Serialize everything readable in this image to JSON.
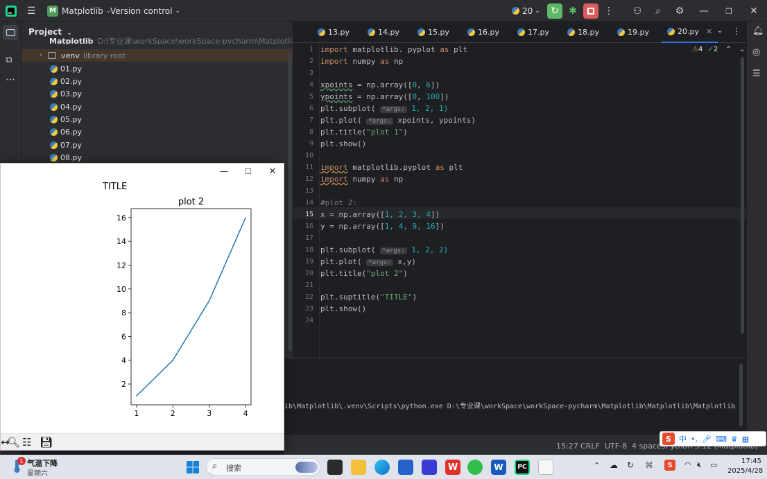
{
  "titlebar": {
    "project_badge": "M",
    "project_name": "Matplotlib",
    "version_control": "Version control",
    "python_version": "20"
  },
  "project_panel": {
    "header": "Project",
    "root_label": "Matplotlib",
    "root_path": "D:\\专业课\\workSpace\\workSpace-pycharm\\Matplotlib\\Matplotlib",
    "venv": ".venv",
    "venv_note": "library root",
    "files": [
      "01.py",
      "02.py",
      "03.py",
      "04.py",
      "05.py",
      "06.py",
      "07.py",
      "08.py"
    ]
  },
  "tabs": [
    "13.py",
    "14.py",
    "15.py",
    "16.py",
    "17.py",
    "18.py",
    "19.py",
    "20.py"
  ],
  "active_tab": "20.py",
  "inspections": {
    "warnings": "4",
    "ok": "2"
  },
  "code_lines": [
    "1",
    "2",
    "3",
    "4",
    "5",
    "6",
    "7",
    "8",
    "9",
    "10",
    "11",
    "12",
    "13",
    "14",
    "15",
    "16",
    "17",
    "18",
    "19",
    "20",
    "21",
    "22",
    "23",
    "24"
  ],
  "code": {
    "l1_a": "import",
    "l1_b": " matplotlib. pyplot ",
    "l1_c": "as",
    "l1_d": " plt",
    "l2_a": "import",
    "l2_b": " numpy ",
    "l2_c": "as",
    "l2_d": " np",
    "l4_a": "xpoints",
    "l4_b": " = np.array([",
    "l4_c": "0",
    "l4_d": ", ",
    "l4_e": "6",
    "l4_f": "])",
    "l5_a": "ypoints",
    "l5_b": " = np.array([",
    "l5_c": "0",
    "l5_d": ", ",
    "l5_e": "100",
    "l5_f": "])",
    "l6_a": "plt.subplot( ",
    "l6_hint": "*args:",
    "l6_b": " 1, 2, 1)",
    "l7_a": "plt.plot( ",
    "l7_hint": "*args:",
    "l7_b": " xpoints, ypoints)",
    "l8_a": "plt.title(",
    "l8_b": "\"plot 1\"",
    "l8_c": ")",
    "l9": "plt.show()",
    "l11_a": "import",
    "l11_b": " matplotlib.pyplot ",
    "l11_c": "as",
    "l11_d": " plt",
    "l12_a": "import",
    "l12_b": " numpy ",
    "l12_c": "as",
    "l12_d": " np",
    "l14": "#plot 2:",
    "l15_a": "x = np.array([",
    "l15_b": "1, 2, 3, 4",
    "l15_c": "])",
    "l16_a": "y = np.array([",
    "l16_b": "1, 4, 9, 16",
    "l16_c": "])",
    "l18_a": "plt.subplot( ",
    "l18_hint": "*args:",
    "l18_b": " 1, 2, 2)",
    "l19_a": "plt.plot( ",
    "l19_hint": "*args:",
    "l19_b": " x,y)",
    "l20_a": "plt.title(",
    "l20_b": "\"plot 2\"",
    "l20_c": ")",
    "l22_a": "plt.suptitle(",
    "l22_b": "\"TITLE\"",
    "l22_c": ")",
    "l23": "plt.show()"
  },
  "run_output": "ib\\Matplotlib\\.venv\\Scripts\\python.exe D:\\专业课\\workSpace\\workSpace-pycharm\\Matplotlib\\Matplotlib\\Matplotlib",
  "statusbar": {
    "position": "15:27",
    "line_sep": "CRLF",
    "encoding": "UTF-8",
    "indent": "4 spaces",
    "interpreter": "Python 3.12 (Matplotlib)"
  },
  "figure": {
    "suptitle": "TITLE"
  },
  "chart_data": {
    "type": "line",
    "title": "plot 2",
    "x": [
      1,
      2,
      3,
      4
    ],
    "y": [
      1,
      4,
      9,
      16
    ],
    "xticks": [
      "1",
      "2",
      "3",
      "4"
    ],
    "yticks": [
      "2",
      "4",
      "6",
      "8",
      "10",
      "12",
      "14",
      "16"
    ],
    "xlim": [
      0.85,
      4.15
    ],
    "ylim": [
      0.25,
      16.75
    ],
    "color": "#1f77b4"
  },
  "taskbar": {
    "weather_badge": "1",
    "weather_title": "气温下降",
    "weather_sub": "星期六",
    "search_placeholder": "搜索",
    "time": "17:45",
    "date": "2025/4/28",
    "ime_label": "中"
  }
}
